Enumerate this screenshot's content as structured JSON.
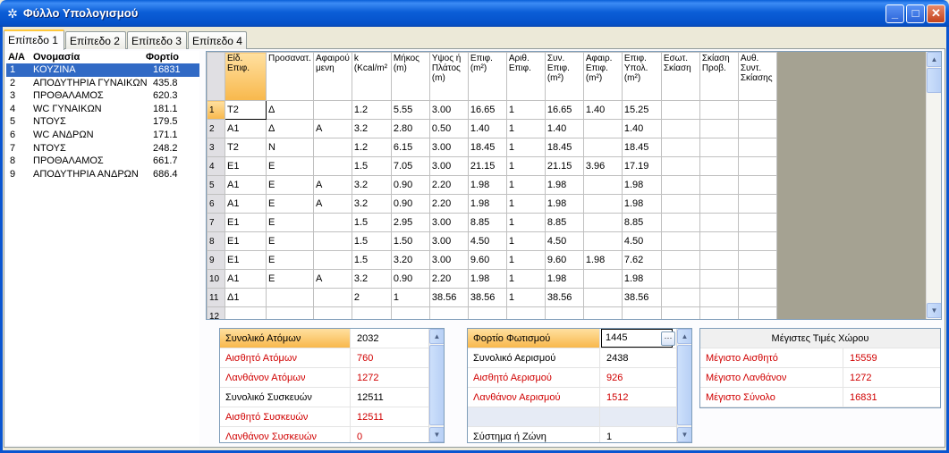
{
  "window": {
    "title": "Φύλλο Υπολογισμού",
    "app_icon": "✲"
  },
  "tabs": [
    "Επίπεδο 1",
    "Επίπεδο 2",
    "Επίπεδο 3",
    "Επίπεδο 4"
  ],
  "rooms": {
    "headers": {
      "index": "A/A",
      "name": "Ονομασία",
      "load": "Φορτίο"
    },
    "rows": [
      {
        "n": "1",
        "name": "ΚΟΥΖΙΝΑ",
        "load": "16831"
      },
      {
        "n": "2",
        "name": "ΑΠΟΔΥΤΗΡΙΑ ΓΥΝΑΙΚΩΝ",
        "load": "435.8"
      },
      {
        "n": "3",
        "name": "ΠΡΟΘΑΛΑΜΟΣ",
        "load": "620.3"
      },
      {
        "n": "4",
        "name": "WC ΓΥΝΑΙΚΩΝ",
        "load": "181.1"
      },
      {
        "n": "5",
        "name": "ΝΤΟΥΣ",
        "load": "179.5"
      },
      {
        "n": "6",
        "name": "WC ΑΝΔΡΩΝ",
        "load": "171.1"
      },
      {
        "n": "7",
        "name": "ΝΤΟΥΣ",
        "load": "248.2"
      },
      {
        "n": "8",
        "name": "ΠΡΟΘΑΛΑΜΟΣ",
        "load": "661.7"
      },
      {
        "n": "9",
        "name": "ΑΠΟΔΥΤΗΡΙΑ ΑΝΔΡΩΝ",
        "load": "686.4"
      }
    ]
  },
  "grid": {
    "columns": [
      "Είδ.\nΕπιφ.",
      "Προσανατ.",
      "Αφαιρού\nμενη",
      "k\n(Kcal/m²",
      "Μήκος\n(m)",
      "Υψος ή\nΠλάτος\n(m)",
      "Επιφ.\n(m²)",
      "Αριθ.\nΕπιφ.",
      "Συν.\nΕπιφ.\n(m²)",
      "Αφαιρ.\nΕπιφ.\n(m²)",
      "Επιφ.\nΥπολ.\n(m²)",
      "Εσωτ.\nΣκίαση",
      "Σκίαση\nΠροβ.",
      "Αυθ.\nΣυντ.\nΣκίασης"
    ],
    "rows": [
      [
        "1",
        "T2",
        "Δ",
        "",
        "1.2",
        "5.55",
        "3.00",
        "16.65",
        "1",
        "16.65",
        "1.40",
        "15.25",
        "",
        "",
        ""
      ],
      [
        "2",
        "A1",
        "Δ",
        "A",
        "3.2",
        "2.80",
        "0.50",
        "1.40",
        "1",
        "1.40",
        "",
        "1.40",
        "",
        "",
        ""
      ],
      [
        "3",
        "T2",
        "N",
        "",
        "1.2",
        "6.15",
        "3.00",
        "18.45",
        "1",
        "18.45",
        "",
        "18.45",
        "",
        "",
        ""
      ],
      [
        "4",
        "E1",
        "E",
        "",
        "1.5",
        "7.05",
        "3.00",
        "21.15",
        "1",
        "21.15",
        "3.96",
        "17.19",
        "",
        "",
        ""
      ],
      [
        "5",
        "A1",
        "E",
        "A",
        "3.2",
        "0.90",
        "2.20",
        "1.98",
        "1",
        "1.98",
        "",
        "1.98",
        "",
        "",
        ""
      ],
      [
        "6",
        "A1",
        "E",
        "A",
        "3.2",
        "0.90",
        "2.20",
        "1.98",
        "1",
        "1.98",
        "",
        "1.98",
        "",
        "",
        ""
      ],
      [
        "7",
        "E1",
        "E",
        "",
        "1.5",
        "2.95",
        "3.00",
        "8.85",
        "1",
        "8.85",
        "",
        "8.85",
        "",
        "",
        ""
      ],
      [
        "8",
        "E1",
        "E",
        "",
        "1.5",
        "1.50",
        "3.00",
        "4.50",
        "1",
        "4.50",
        "",
        "4.50",
        "",
        "",
        ""
      ],
      [
        "9",
        "E1",
        "E",
        "",
        "1.5",
        "3.20",
        "3.00",
        "9.60",
        "1",
        "9.60",
        "1.98",
        "7.62",
        "",
        "",
        ""
      ],
      [
        "10",
        "A1",
        "E",
        "A",
        "3.2",
        "0.90",
        "2.20",
        "1.98",
        "1",
        "1.98",
        "",
        "1.98",
        "",
        "",
        ""
      ],
      [
        "11",
        "Δ1",
        "",
        "",
        "2",
        "1",
        "38.56",
        "38.56",
        "1",
        "38.56",
        "",
        "38.56",
        "",
        "",
        ""
      ],
      [
        "12",
        "",
        "",
        "",
        "",
        "",
        "",
        "",
        "",
        "",
        "",
        "",
        "",
        "",
        ""
      ]
    ]
  },
  "panel_people": [
    {
      "label": "Συνολικό Ατόμων",
      "value": "2032",
      "red": false
    },
    {
      "label": "Αισθητό Ατόμων",
      "value": "760",
      "red": true
    },
    {
      "label": "Λανθάνον Ατόμων",
      "value": "1272",
      "red": true
    },
    {
      "label": "Συνολικό Συσκευών",
      "value": "12511",
      "red": false
    },
    {
      "label": "Αισθητό Συσκευών",
      "value": "12511",
      "red": true
    },
    {
      "label": "Λανθάνον Συσκευών",
      "value": "0",
      "red": true
    }
  ],
  "panel_air": [
    {
      "label": "Φορτίο Φωτισμού",
      "value": "1445",
      "red": false
    },
    {
      "label": "Συνολικό Αερισμού",
      "value": "2438",
      "red": false
    },
    {
      "label": "Αισθητό Αερισμού",
      "value": "926",
      "red": true
    },
    {
      "label": "Λανθάνον Αερισμού",
      "value": "1512",
      "red": true
    },
    {
      "label": "",
      "value": "",
      "red": false
    },
    {
      "label": "Σύστημα ή Ζώνη",
      "value": "1",
      "red": false
    }
  ],
  "panel_max": {
    "title": "Μέγιστες Τιμές Χώρου",
    "rows": [
      {
        "label": "Μέγιστο Αισθητό",
        "value": "15559"
      },
      {
        "label": "Μέγιστο Λανθάνον",
        "value": "1272"
      },
      {
        "label": "Μέγιστο Σύνολο",
        "value": "16831"
      }
    ]
  },
  "colors": {
    "titlebar": "#0b5ed7",
    "selection": "#316ac5",
    "header_highlight": "#f8b84c",
    "red_text": "#d00000"
  }
}
